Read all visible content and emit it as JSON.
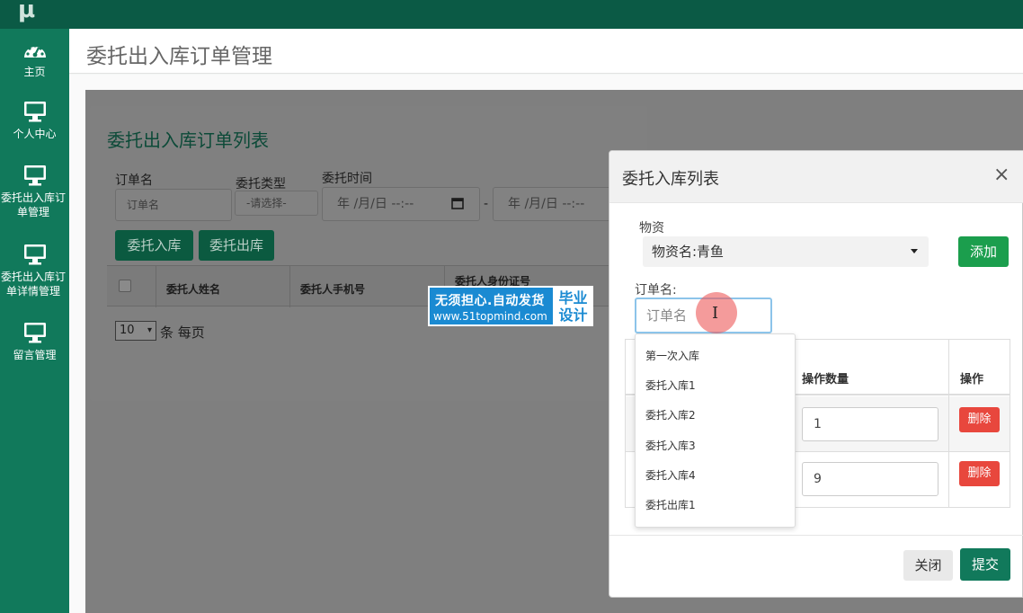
{
  "app": {
    "logo": "μ"
  },
  "sidebar": {
    "items": [
      {
        "label": "主页",
        "icon": "dashboard-icon"
      },
      {
        "label": "个人中心",
        "icon": "monitor-icon"
      },
      {
        "label": "委托出入库订单管理",
        "icon": "monitor-icon"
      },
      {
        "label": "委托出入库订单详情管理",
        "icon": "monitor-icon"
      },
      {
        "label": "留言管理",
        "icon": "monitor-icon"
      }
    ]
  },
  "header": {
    "title": "委托出入库订单管理"
  },
  "card": {
    "title": "委托出入库订单列表",
    "filters": {
      "order_name_label": "订单名",
      "order_name_placeholder": "订单名",
      "type_label": "委托类型",
      "type_value": "-请选择-",
      "time_label": "委托时间",
      "date_from": "年 /月/日  --:--",
      "date_sep": "-",
      "date_to": "年 /月/日  --:--"
    },
    "buttons": {
      "inbound": "委托入库",
      "outbound": "委托出库"
    },
    "table_headers": [
      "委托人姓名",
      "委托人手机号",
      "委托人身份证号"
    ],
    "pager": {
      "size": "10",
      "suffix": "条 每页"
    }
  },
  "watermark": {
    "line1": "无须担心.自动发货",
    "line2": "www.51topmind.com",
    "badge1": "毕业",
    "badge2": "设计"
  },
  "modal": {
    "title": "委托入库列表",
    "close_symbol": "×",
    "material_label": "物资",
    "material_value": "物资名:青鱼",
    "add_label": "添加",
    "order_label": "订单名:",
    "order_placeholder": "订单名",
    "table": {
      "headers": [
        "操作数量",
        "操作"
      ],
      "rows": [
        {
          "qty": "1",
          "action": "删除"
        },
        {
          "qty": "9",
          "action": "删除"
        }
      ]
    },
    "dropdown": [
      "第一次入库",
      "委托入库1",
      "委托入库2",
      "委托入库3",
      "委托入库4",
      "委托出库1"
    ],
    "close_label": "关闭",
    "submit_label": "提交"
  },
  "colors": {
    "topbar": "#0b5a45",
    "sidebar": "#11795b",
    "primary": "#11795b",
    "success": "#1b9e4d",
    "danger": "#e8473d"
  }
}
